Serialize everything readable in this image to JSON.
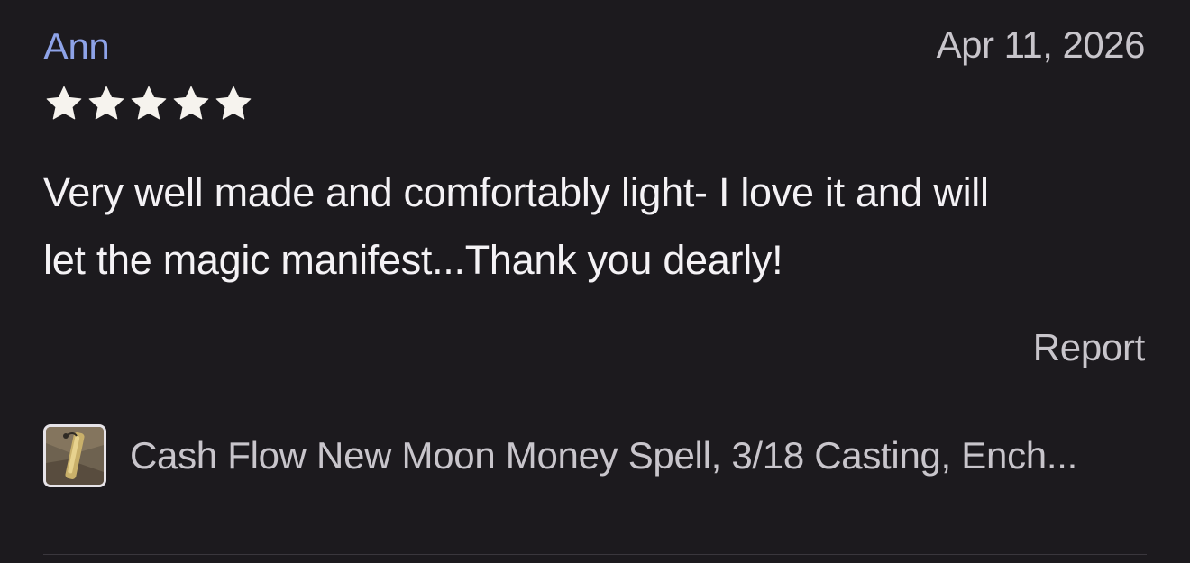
{
  "review": {
    "reviewer_name": "Ann",
    "date": "Apr 11, 2026",
    "rating": 5,
    "rating_max": 5,
    "text_line1": "Very well made and comfortably light- I love it and will",
    "text_line2": "let the magic manifest...Thank you dearly!",
    "report_label": "Report"
  },
  "product": {
    "title": "Cash Flow New Moon Money Spell, 3/18 Casting, Ench...",
    "thumbnail_icon": "product-photo"
  },
  "colors": {
    "background": "#1c1a1e",
    "reviewer_name": "#8ea3e8",
    "secondary_text": "#c8c5cb",
    "primary_text": "#f4f2f5",
    "star": "#f6f3ee"
  }
}
